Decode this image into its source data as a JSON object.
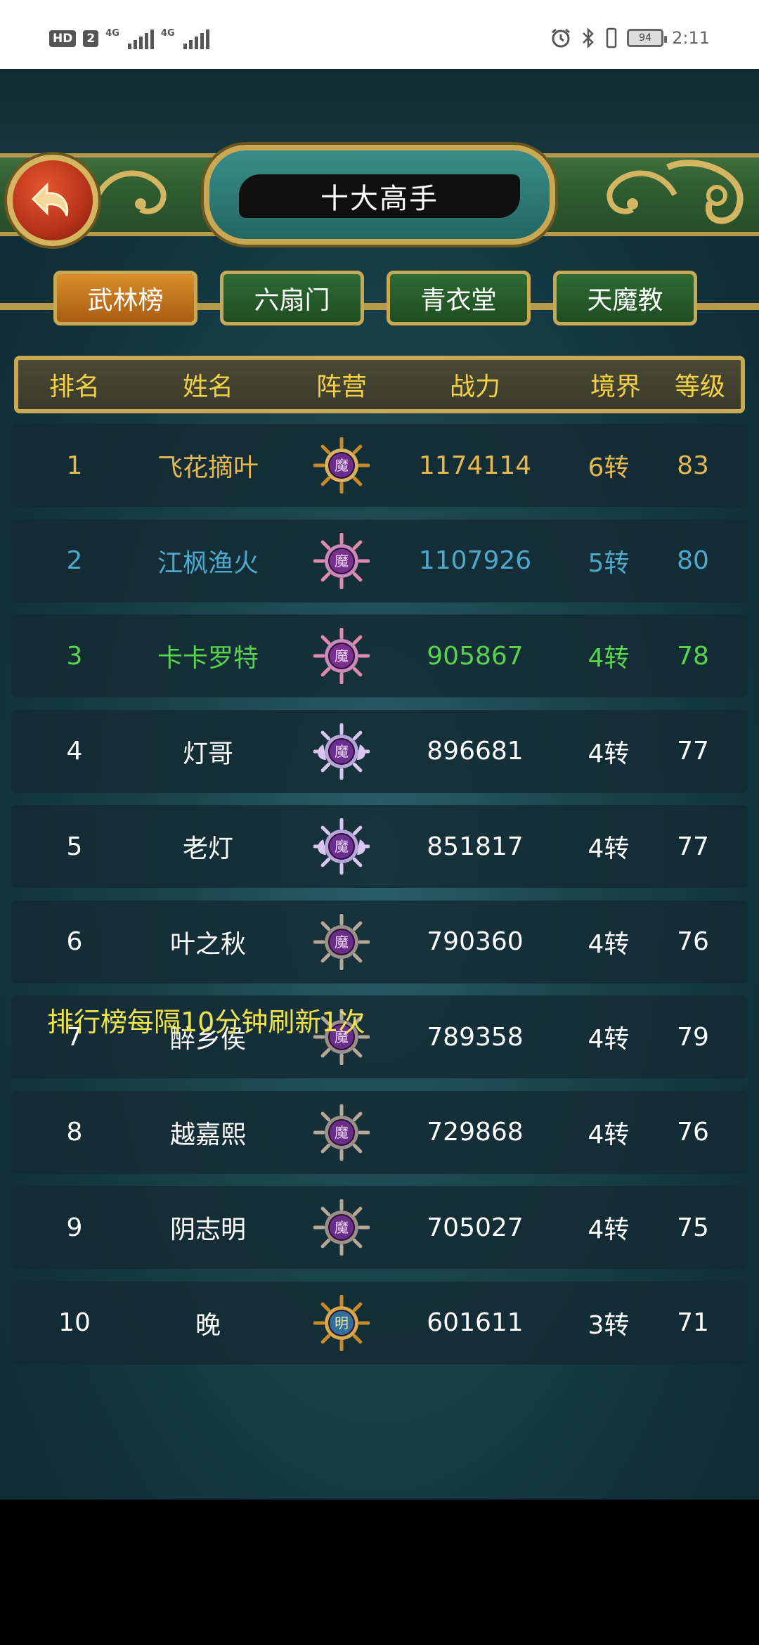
{
  "status_bar": {
    "badge_hd": "HD",
    "badge_sim": "2",
    "net1": "4G",
    "net2": "4G",
    "battery": "94",
    "time": "2:11"
  },
  "header": {
    "title": "十大高手"
  },
  "tabs": [
    {
      "label": "武林榜",
      "active": true
    },
    {
      "label": "六扇门",
      "active": false
    },
    {
      "label": "青衣堂",
      "active": false
    },
    {
      "label": "天魔教",
      "active": false
    }
  ],
  "table": {
    "columns": [
      "排名",
      "姓名",
      "阵营",
      "战力",
      "境界",
      "等级"
    ],
    "rows": [
      {
        "rank": "1",
        "name": "飞花摘叶",
        "camp": "魔",
        "power": "1174114",
        "realm": "6转",
        "level": "83",
        "color": "#e7b84d",
        "emblem": "gold"
      },
      {
        "rank": "2",
        "name": "江枫渔火",
        "camp": "魔",
        "power": "1107926",
        "realm": "5转",
        "level": "80",
        "color": "#4fa8cc",
        "emblem": "pink"
      },
      {
        "rank": "3",
        "name": "卡卡罗特",
        "camp": "魔",
        "power": "905867",
        "realm": "4转",
        "level": "78",
        "color": "#59d24c",
        "emblem": "pink"
      },
      {
        "rank": "4",
        "name": "灯哥",
        "camp": "魔",
        "power": "896681",
        "realm": "4转",
        "level": "77",
        "color": "#ffffff",
        "emblem": "wing"
      },
      {
        "rank": "5",
        "name": "老灯",
        "camp": "魔",
        "power": "851817",
        "realm": "4转",
        "level": "77",
        "color": "#ffffff",
        "emblem": "wing"
      },
      {
        "rank": "6",
        "name": "叶之秋",
        "camp": "魔",
        "power": "790360",
        "realm": "4转",
        "level": "76",
        "color": "#ffffff",
        "emblem": "plain"
      },
      {
        "rank": "7",
        "name": "醉乡侯",
        "camp": "魔",
        "power": "789358",
        "realm": "4转",
        "level": "79",
        "color": "#ffffff",
        "emblem": "plain"
      },
      {
        "rank": "8",
        "name": "越嘉熙",
        "camp": "魔",
        "power": "729868",
        "realm": "4转",
        "level": "76",
        "color": "#ffffff",
        "emblem": "plain"
      },
      {
        "rank": "9",
        "name": "阴志明",
        "camp": "魔",
        "power": "705027",
        "realm": "4转",
        "level": "75",
        "color": "#ffffff",
        "emblem": "plain"
      },
      {
        "rank": "10",
        "name": "晚",
        "camp": "明",
        "power": "601611",
        "realm": "3转",
        "level": "71",
        "color": "#ffffff",
        "emblem": "ming"
      }
    ]
  },
  "footer": {
    "note": "排行榜每隔10分钟刷新1次"
  },
  "colors": {
    "header_text": "#f3d147",
    "gold_border": "#c9a853",
    "note_text": "#f0e34c"
  },
  "icons": {
    "back": "back-arrow-icon",
    "camp_demon": "demon-emblem-icon",
    "camp_ming": "ming-emblem-icon"
  }
}
